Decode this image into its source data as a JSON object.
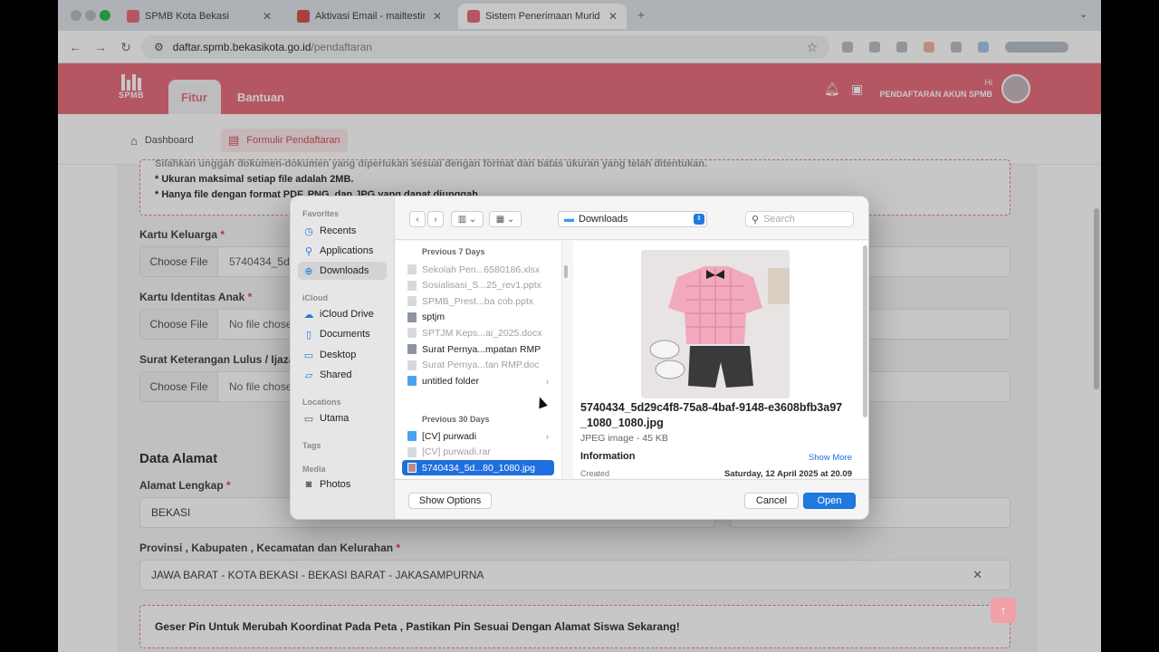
{
  "browser": {
    "tabs": [
      {
        "title": "SPMB Kota Bekasi",
        "favicon_color": "#e8707f"
      },
      {
        "title": "Aktivasi Email - mailtesting…",
        "favicon_color": "#d9534f"
      },
      {
        "title": "Sistem Penerimaan Murid Ba…",
        "favicon_color": "#e8707f"
      }
    ],
    "url_host": "daftar.spmb.bekasikota.go.id",
    "url_path": "/pendaftaran"
  },
  "header": {
    "logo_text": "SPMB",
    "tabs": [
      "Fitur",
      "Bantuan"
    ],
    "greeting": "Hi",
    "account": "PENDAFTARAN AKUN SPMB"
  },
  "breadcrumb": {
    "dashboard": "Dashboard",
    "form": "Formulir Pendaftaran"
  },
  "form": {
    "notice_lines": [
      "Silahkan unggah dokumen-dokumen yang diperlukan sesuai dengan format dan batas ukuran yang telah ditentukan.",
      "* Ukuran maksimal setiap file adalah 2MB.",
      "* Hanya file dengan format PDF, PNG, dan JPG yang dapat diunggah."
    ],
    "kk_label": "Kartu Keluarga",
    "kk_file": "5740434_5d",
    "kia_label": "Kartu Identitas Anak",
    "kia_file": "No file chosen",
    "skl_label": "Surat Keterangan Lulus / Ijaza",
    "skl_file": "No file chose",
    "choose_file": "Choose File",
    "address_section": "Data Alamat",
    "alamat_label": "Alamat Lengkap",
    "alamat_value": "BEKASI",
    "provinsi_label": "Provinsi , Kabupaten , Kecamatan dan Kelurahan",
    "provinsi_value": "JAWA BARAT - KOTA BEKASI - BEKASI BARAT - JAKASAMPURNA",
    "pin_notice": "Geser Pin Untuk Merubah Koordinat Pada Peta , Pastikan Pin Sesuai Dengan Alamat Siswa Sekarang!"
  },
  "dialog": {
    "sidebar": {
      "favorites_head": "Favorites",
      "favorites": [
        "Recents",
        "Applications",
        "Downloads"
      ],
      "icloud_head": "iCloud",
      "icloud": [
        "iCloud Drive",
        "Documents",
        "Desktop",
        "Shared"
      ],
      "locations_head": "Locations",
      "locations": [
        "Utama"
      ],
      "tags_head": "Tags",
      "media_head": "Media",
      "media": [
        "Photos"
      ]
    },
    "location": "Downloads",
    "search_placeholder": "Search",
    "groups": [
      {
        "head": "Previous 7 Days",
        "files": [
          {
            "name": "Sekolah Pen...6580186.xlsx",
            "dim": true,
            "kind": "doc"
          },
          {
            "name": "Sosialisasi_S...25_rev1.pptx",
            "dim": true,
            "kind": "doc"
          },
          {
            "name": "SPMB_Prest...ba cob.pptx",
            "dim": true,
            "kind": "doc"
          },
          {
            "name": "sptjm",
            "dim": false,
            "kind": "doc"
          },
          {
            "name": "SPTJM Keps...ai_2025.docx",
            "dim": true,
            "kind": "doc"
          },
          {
            "name": "Surat Pernya...mpatan RMP",
            "dim": false,
            "kind": "doc"
          },
          {
            "name": "Surat Pernya...tan RMP.doc",
            "dim": true,
            "kind": "doc"
          },
          {
            "name": "untitled folder",
            "dim": false,
            "kind": "folder"
          }
        ]
      },
      {
        "head": "Previous 30 Days",
        "files": [
          {
            "name": "[CV] purwadi",
            "dim": false,
            "kind": "folder"
          },
          {
            "name": "[CV] purwadi.rar",
            "dim": true,
            "kind": "doc"
          },
          {
            "name": "5740434_5d...80_1080.jpg",
            "dim": false,
            "kind": "image",
            "selected": true
          }
        ]
      }
    ],
    "preview": {
      "filename": "5740434_5d29c4f8-75a8-4baf-9148-e3608bfb3a97_1080_1080.jpg",
      "kind": "JPEG image - 45 KB",
      "info_head": "Information",
      "show_more": "Show More",
      "created_label": "Created",
      "created_value": "Saturday, 12 April 2025 at 20.09"
    },
    "show_options": "Show Options",
    "cancel": "Cancel",
    "open": "Open"
  }
}
